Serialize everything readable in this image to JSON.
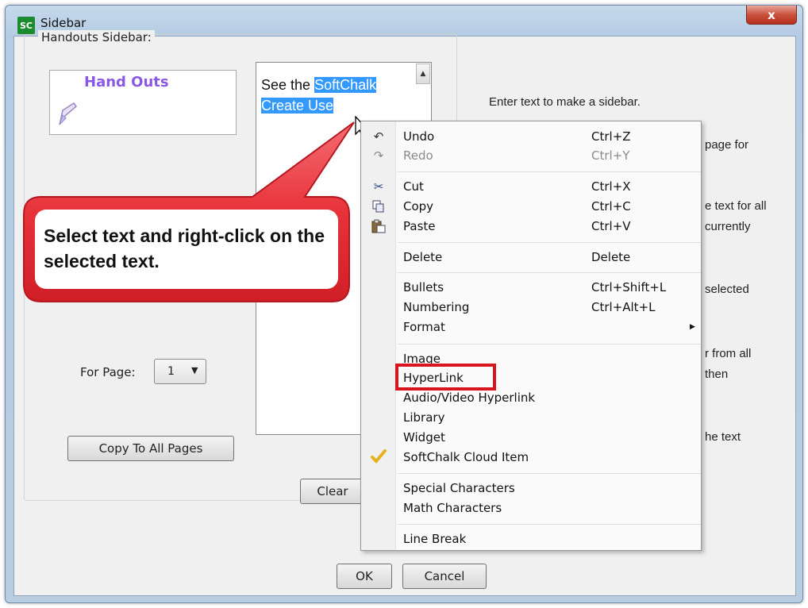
{
  "window": {
    "title": "Sidebar",
    "app_icon": "SC",
    "close_glyph": "x"
  },
  "sidebar": {
    "group_label": "Handouts Sidebar:",
    "preview_title": "Hand Outs",
    "editor_text": {
      "before": "See the ",
      "selected_line1": "SoftChalk",
      "selected_line2": "Create Use"
    },
    "page_label": "For Page:",
    "page_value": "1",
    "copy_button": "Copy To All Pages",
    "clear_button": "Clear"
  },
  "instructions": {
    "line1": "Enter text to make a sidebar.",
    "line2": "page for",
    "line3": "e text for all",
    "line4": "currently",
    "line5": "selected",
    "line6": "r from all",
    "line7": "then",
    "line8": "he text"
  },
  "callout": {
    "text": "Select text and right-click on the selected text."
  },
  "context_menu": {
    "undo": {
      "label": "Undo",
      "shortcut": "Ctrl+Z"
    },
    "redo": {
      "label": "Redo",
      "shortcut": "Ctrl+Y"
    },
    "cut": {
      "label": "Cut",
      "shortcut": "Ctrl+X"
    },
    "copy": {
      "label": "Copy",
      "shortcut": "Ctrl+C"
    },
    "paste": {
      "label": "Paste",
      "shortcut": "Ctrl+V"
    },
    "delete": {
      "label": "Delete",
      "shortcut": "Delete"
    },
    "bullets": {
      "label": "Bullets",
      "shortcut": "Ctrl+Shift+L"
    },
    "numbering": {
      "label": "Numbering",
      "shortcut": "Ctrl+Alt+L"
    },
    "format": {
      "label": "Format"
    },
    "image": {
      "label": "Image"
    },
    "hyperlink": {
      "label": "HyperLink"
    },
    "av_hyperlink": {
      "label": "Audio/Video Hyperlink"
    },
    "library": {
      "label": "Library"
    },
    "widget": {
      "label": "Widget"
    },
    "cloud_item": {
      "label": "SoftChalk Cloud Item"
    },
    "special_chars": {
      "label": "Special Characters"
    },
    "math_chars": {
      "label": "Math Characters"
    },
    "line_break": {
      "label": "Line Break"
    }
  },
  "footer": {
    "ok": "OK",
    "cancel": "Cancel"
  },
  "colors": {
    "accent": "#8a58e6",
    "callout_red": "#e8323a",
    "highlight_red": "#d8141d",
    "selection": "#3399ff"
  }
}
